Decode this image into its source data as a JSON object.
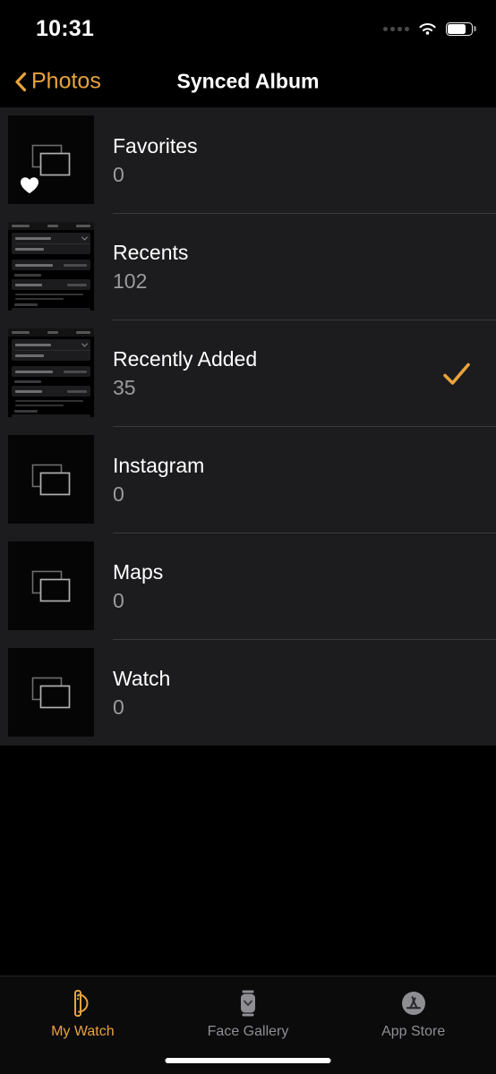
{
  "status_bar": {
    "time": "10:31",
    "signal_icon": "signal-dots-icon",
    "wifi_icon": "wifi-icon",
    "battery_icon": "battery-icon",
    "battery_level": 65
  },
  "nav": {
    "back_label": "Photos",
    "back_icon": "chevron-left-icon",
    "title": "Synced Album",
    "accent_color": "#e8a33d"
  },
  "list": {
    "rows": [
      {
        "name": "Favorites",
        "count": "0",
        "thumbnail": "empty-album-placeholder",
        "badge_icon": "heart-icon",
        "selected": false
      },
      {
        "name": "Recents",
        "count": "102",
        "thumbnail": "settings-screenshot",
        "badge_icon": "",
        "selected": false
      },
      {
        "name": "Recently Added",
        "count": "35",
        "thumbnail": "settings-screenshot",
        "badge_icon": "",
        "selected": true
      },
      {
        "name": "Instagram",
        "count": "0",
        "thumbnail": "empty-album-placeholder",
        "badge_icon": "",
        "selected": false
      },
      {
        "name": "Maps",
        "count": "0",
        "thumbnail": "empty-album-placeholder",
        "badge_icon": "",
        "selected": false
      },
      {
        "name": "Watch",
        "count": "0",
        "thumbnail": "empty-album-placeholder",
        "badge_icon": "",
        "selected": false
      }
    ],
    "check_icon": "checkmark-icon",
    "check_color": "#e8a33d",
    "background_color": "#1c1c1e",
    "separator_color": "#3a3a3c"
  },
  "tab_bar": {
    "tabs": [
      {
        "label": "My Watch",
        "icon": "watch-outline-icon",
        "active": true
      },
      {
        "label": "Face Gallery",
        "icon": "watch-face-icon",
        "active": false
      },
      {
        "label": "App Store",
        "icon": "app-store-icon",
        "active": false
      }
    ],
    "active_color": "#e8a33d",
    "inactive_color": "#8e8e93"
  }
}
